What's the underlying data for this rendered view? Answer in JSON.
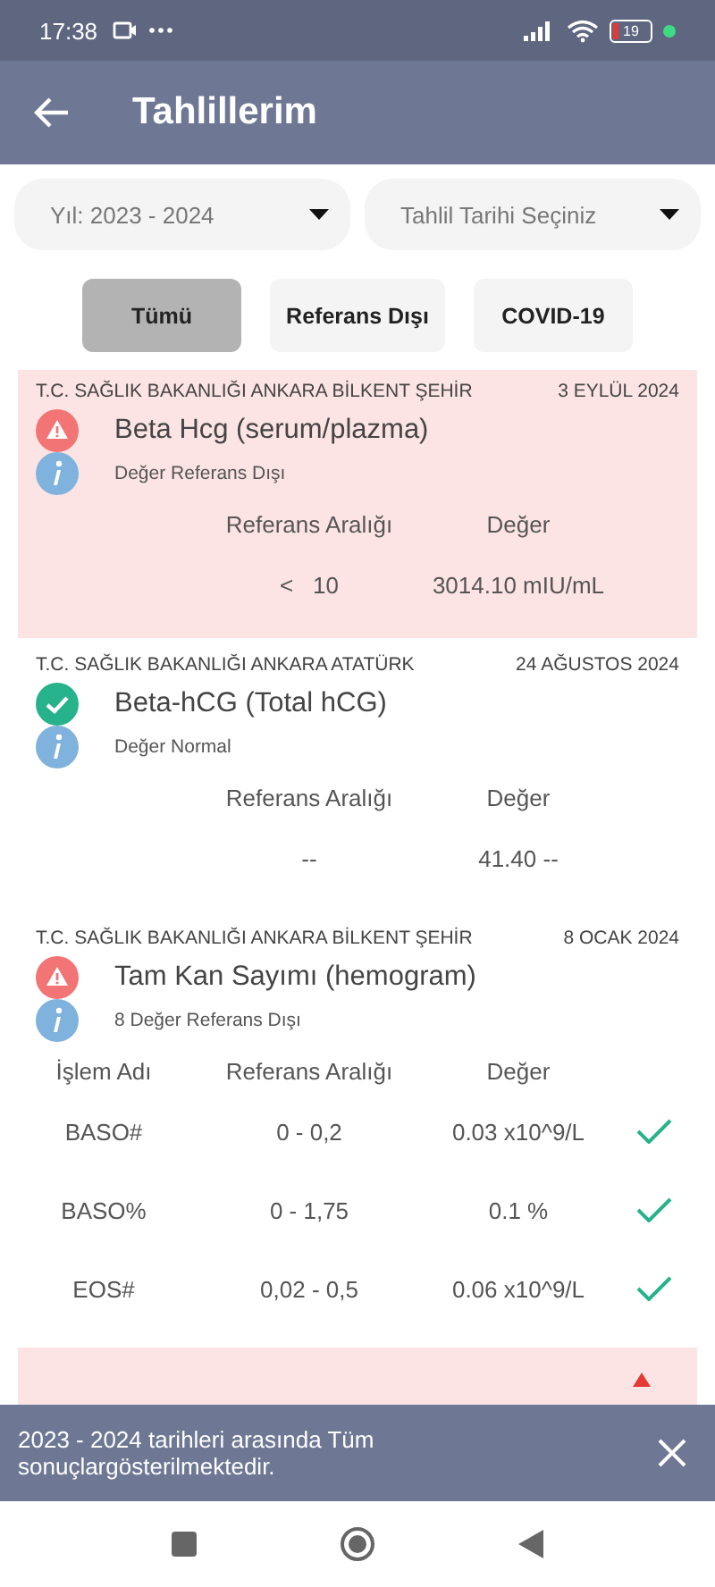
{
  "status_bar": {
    "time": "17:38",
    "battery": "19"
  },
  "app_bar": {
    "title": "Tahlillerim"
  },
  "filters": [
    {
      "value": "Yıl: 2023 - 2024"
    },
    {
      "placeholder": "Tahlil Tarihi Seçiniz"
    }
  ],
  "chips": [
    {
      "label": "Tümü",
      "selected": true
    },
    {
      "label": "Referans Dışı",
      "selected": false
    },
    {
      "label": "COVID-19",
      "selected": false
    }
  ],
  "cards": [
    {
      "kind": "out_of_range",
      "hospital": "T.C. SAĞLIK BAKANLIĞI ANKARA BİLKENT ŞEHİR",
      "date": "3 EYLÜL 2024",
      "title": "Beta Hcg (serum/plazma)",
      "note": "Değer Referans Dışı",
      "columns": [
        "Referans Aralığı",
        "Değer"
      ],
      "rows": [
        {
          "range": "<   10",
          "value": "3014.10 mIU/mL"
        }
      ]
    },
    {
      "kind": "normal",
      "hospital": "T.C. SAĞLIK BAKANLIĞI ANKARA ATATÜRK",
      "date": "24 AĞUSTOS 2024",
      "title": "Beta-hCG (Total hCG)",
      "note": "Değer Normal",
      "columns": [
        "Referans Aralığı",
        "Değer"
      ],
      "rows": [
        {
          "range": "--",
          "value": "41.40 --"
        }
      ]
    },
    {
      "kind": "out_of_range_plain",
      "hospital": "T.C. SAĞLIK BAKANLIĞI ANKARA BİLKENT ŞEHİR",
      "date": "8 OCAK 2024",
      "title": "Tam Kan Sayımı (hemogram)",
      "note": "8 Değer Referans Dışı",
      "columns": [
        "İşlem Adı",
        "Referans Aralığı",
        "Değer"
      ],
      "rows": [
        {
          "name": "BASO#",
          "range": "0 - 0,2",
          "value": "0.03 x10^9/L",
          "in_range": true
        },
        {
          "name": "BASO%",
          "range": "0 - 1,75",
          "value": "0.1 %",
          "in_range": true
        },
        {
          "name": "EOS#",
          "range": "0,02 - 0,5",
          "value": "0.06 x10^9/L",
          "in_range": true
        }
      ]
    },
    {
      "kind": "out_of_range"
    }
  ],
  "snackbar": {
    "message": "2023 - 2024 tarihleri arasında Tüm sonuçlargösterilmektedir."
  }
}
